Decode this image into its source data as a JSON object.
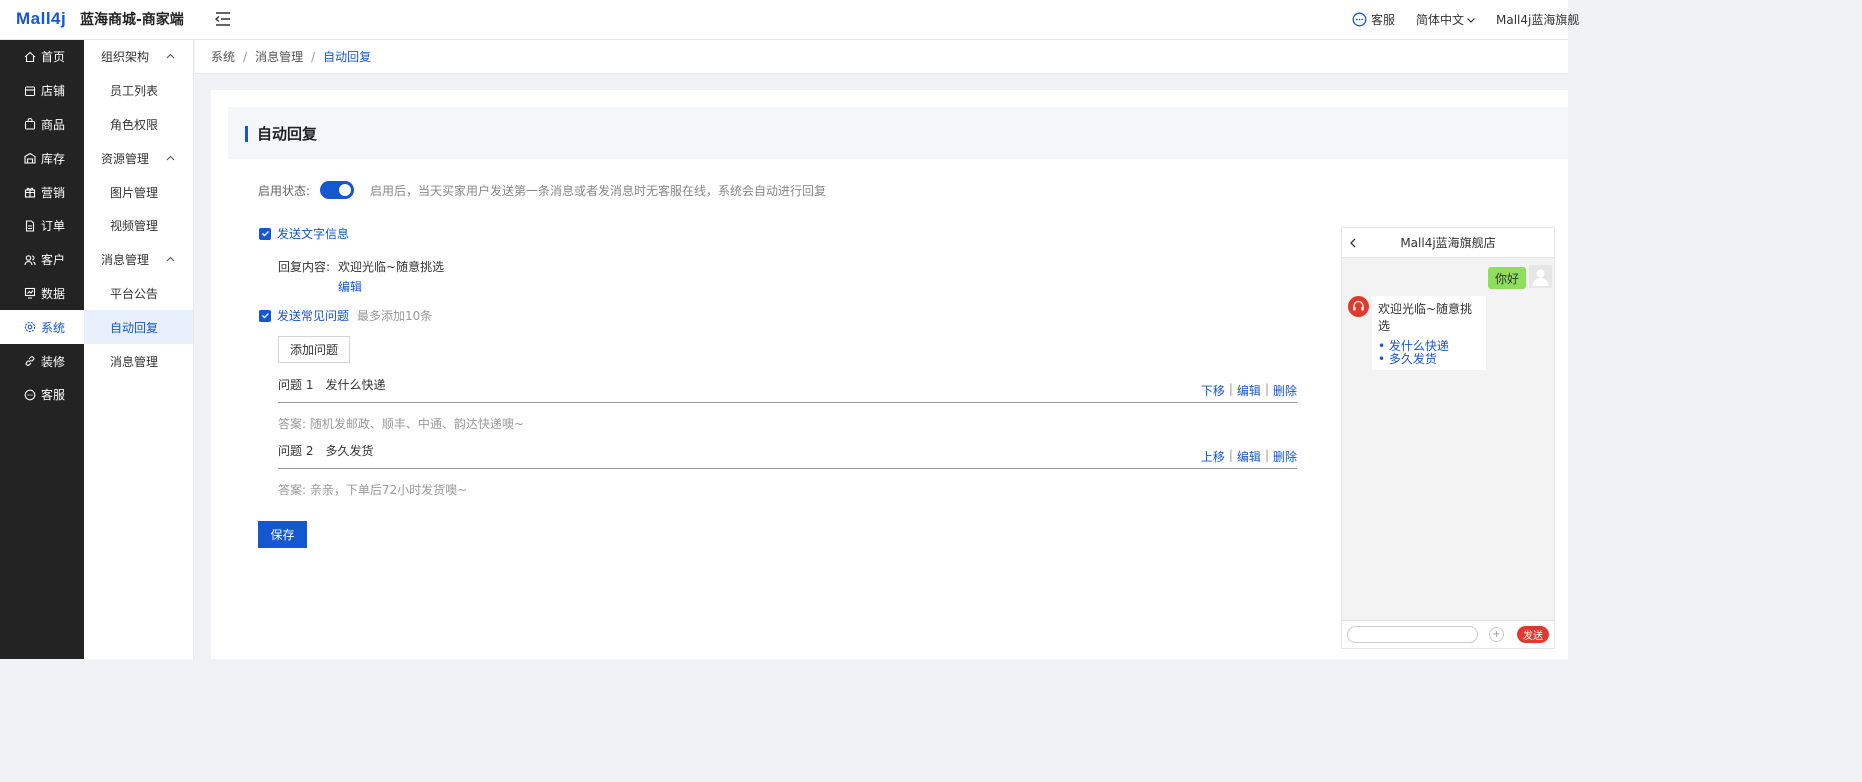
{
  "header": {
    "logo": "Mall4j",
    "app_title": "蓝海商城-商家端",
    "customer_service": "客服",
    "language": "简体中文",
    "user": "Mall4j蓝海旗舰"
  },
  "primary_nav": [
    {
      "label": "首页",
      "icon": "home-icon"
    },
    {
      "label": "店铺",
      "icon": "shop-icon"
    },
    {
      "label": "商品",
      "icon": "bag-icon"
    },
    {
      "label": "库存",
      "icon": "warehouse-icon"
    },
    {
      "label": "营销",
      "icon": "gift-icon"
    },
    {
      "label": "订单",
      "icon": "order-icon"
    },
    {
      "label": "客户",
      "icon": "users-icon"
    },
    {
      "label": "数据",
      "icon": "chart-icon"
    },
    {
      "label": "系统",
      "icon": "gear-icon",
      "active": true
    },
    {
      "label": "装修",
      "icon": "link-icon"
    },
    {
      "label": "客服",
      "icon": "chat-icon"
    }
  ],
  "secondary_nav": [
    {
      "group": "组织架构",
      "items": [
        "员工列表",
        "角色权限"
      ]
    },
    {
      "group": "资源管理",
      "items": [
        "图片管理",
        "视频管理"
      ]
    },
    {
      "group": "消息管理",
      "items": [
        "平台公告",
        "自动回复",
        "消息管理"
      ]
    }
  ],
  "secondary_active": "自动回复",
  "breadcrumb": [
    "系统",
    "消息管理",
    "自动回复"
  ],
  "page": {
    "section_title": "自动回复",
    "status_label": "启用状态:",
    "status_enabled": true,
    "status_hint": "启用后，当天买家用户发送第一条消息或者发消息时无客服在线，系统会自动进行回复",
    "send_text_label": "发送文字信息",
    "reply_label": "回复内容:",
    "reply_value": "欢迎光临~随意挑选",
    "edit_label": "编辑",
    "send_faq_label": "发送常见问题",
    "faq_limit_hint": "最多添加10条",
    "add_question_label": "添加问题",
    "questions": [
      {
        "index": "问题 1",
        "text": "发什么快递",
        "move": "下移",
        "edit": "编辑",
        "delete": "删除",
        "answer": "答案: 随机发邮政、顺丰、中通、韵达快递噢~"
      },
      {
        "index": "问题 2",
        "text": "多久发货",
        "move": "上移",
        "edit": "编辑",
        "delete": "删除",
        "answer": "答案: 亲亲，下单后72小时发货噢~"
      }
    ],
    "save_label": "保存"
  },
  "preview": {
    "shop_name": "Mall4j蓝海旗舰店",
    "user_message": "你好",
    "shop_reply": "欢迎光临~随意挑选",
    "quick_questions": [
      "• 发什么快递",
      "• 多久发货"
    ],
    "send_label": "发送",
    "plus_label": "+"
  },
  "colors": {
    "primary": "#1557d0",
    "sidebar_bg": "#232323",
    "bubble_green": "#8ee05c",
    "send_red": "#e2392f"
  }
}
